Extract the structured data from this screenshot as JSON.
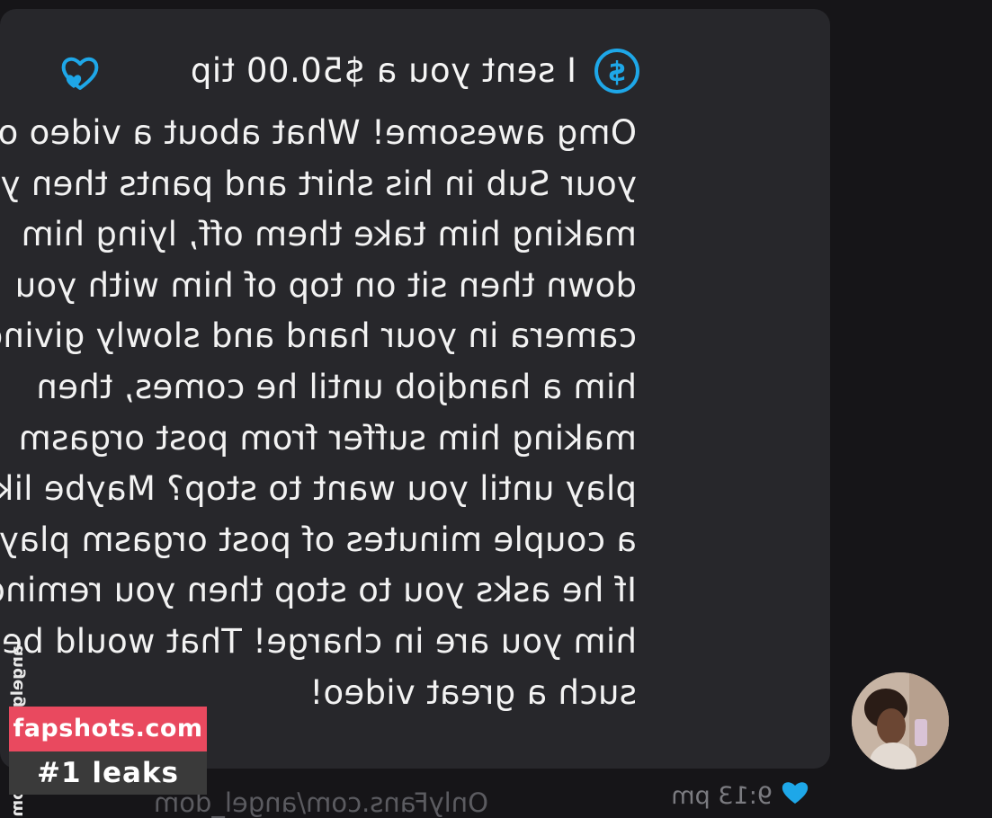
{
  "tip": {
    "text": "I sent you a $50.00 tip",
    "icon": "dollar-circle-icon",
    "reaction_icon": "heart-icon",
    "accent": "#1ea7e8"
  },
  "message": {
    "lines": [
      "Omg awesome! What about a video of",
      "your Sub in his shirt and pants then you",
      "making him take them off, lying him",
      "down then sit on top of him with you",
      "camera in your hand and slowly giving",
      "him a handjob until he comes, then",
      "making him suffer from post orgasm",
      "play until you want to stop? Maybe like",
      "a couple minutes of post orgasm play?",
      "If he asks you to stop then you remind",
      "him you are in charge! That would be",
      "such a great video!"
    ]
  },
  "meta": {
    "time": "9:13 pm",
    "url": "OnlyFans.com/angel_dom"
  },
  "side_watermark": "angelgoddolly.com",
  "watermark": {
    "line1": "fapshots.com",
    "line2": "#1 leaks"
  },
  "colors": {
    "background": "#161518",
    "bubble": "#27272b",
    "accent": "#1ea7e8",
    "watermark_red": "#e9495f"
  }
}
